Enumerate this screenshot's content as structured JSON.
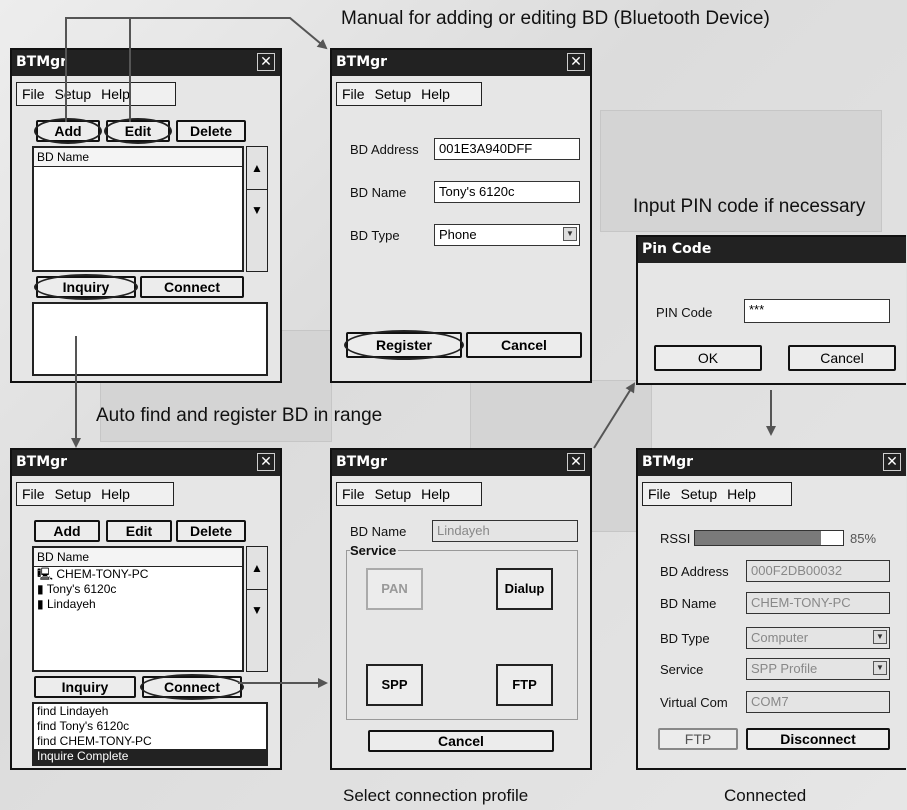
{
  "captions": {
    "manual": "Manual for adding or editing BD (Bluetooth Device)",
    "pin": "Input PIN code if necessary",
    "auto": "Auto find and register BD in range",
    "select": "Select connection profile",
    "connected": "Connected"
  },
  "common": {
    "app_title": "BTMgr",
    "menu": [
      "File",
      "Setup",
      "Help"
    ],
    "close": "✕"
  },
  "w1": {
    "add": "Add",
    "edit": "Edit",
    "delete": "Delete",
    "list_header": "BD Name",
    "inquiry": "Inquiry",
    "connect": "Connect"
  },
  "w2": {
    "bd_address_label": "BD Address",
    "bd_address_value": "001E3A940DFF",
    "bd_name_label": "BD Name",
    "bd_name_value": "Tony's 6120c",
    "bd_type_label": "BD Type",
    "bd_type_value": "Phone",
    "register": "Register",
    "cancel": "Cancel"
  },
  "pin_dialog": {
    "title": "Pin Code",
    "label": "PIN Code",
    "value": "***",
    "ok": "OK",
    "cancel": "Cancel"
  },
  "w4": {
    "add": "Add",
    "edit": "Edit",
    "delete": "Delete",
    "list_header": "BD Name",
    "devices": [
      "CHEM-TONY-PC",
      "Tony's 6120c",
      "Lindayeh"
    ],
    "inquiry": "Inquiry",
    "connect": "Connect",
    "log": [
      "find Lindayeh",
      "find Tony's 6120c",
      "find CHEM-TONY-PC",
      "Inquire Complete"
    ]
  },
  "w5": {
    "bd_name_label": "BD Name",
    "bd_name_value": "Lindayeh",
    "service_label": "Service",
    "pan": "PAN",
    "dialup": "Dialup",
    "spp": "SPP",
    "ftp": "FTP",
    "cancel": "Cancel"
  },
  "w6": {
    "rssi_label": "RSSI",
    "rssi_value": "85%",
    "rssi_level": 0.85,
    "bd_address_label": "BD Address",
    "bd_address_value": "000F2DB00032",
    "bd_name_label": "BD Name",
    "bd_name_value": "CHEM-TONY-PC",
    "bd_type_label": "BD Type",
    "bd_type_value": "Computer",
    "service_label": "Service",
    "service_value": "SPP Profile",
    "vcom_label": "Virtual Com",
    "vcom_value": "COM7",
    "ftp": "FTP",
    "disconnect": "Disconnect"
  }
}
